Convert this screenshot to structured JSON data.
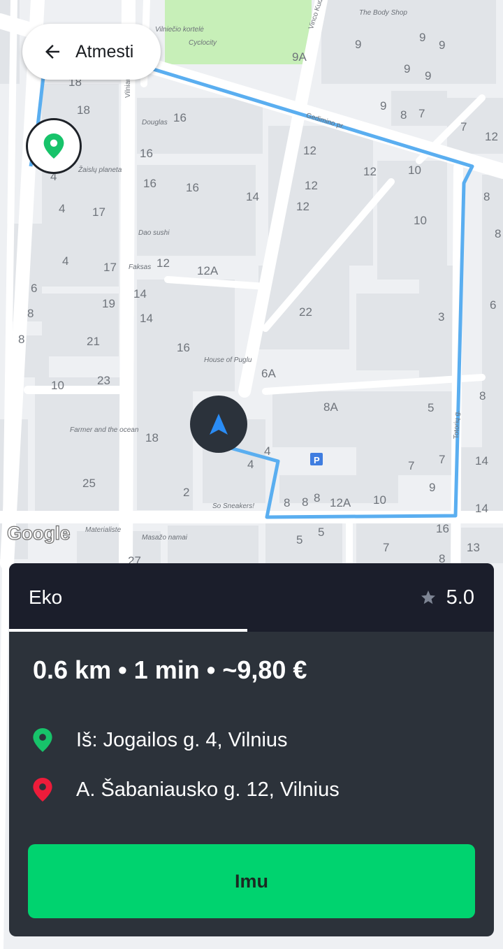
{
  "header": {
    "back_label": "Atmesti"
  },
  "map": {
    "building_numbers": [
      "18",
      "18",
      "16",
      "16",
      "16",
      "16",
      "14",
      "17",
      "4",
      "4",
      "17",
      "12",
      "12A",
      "4",
      "6",
      "19",
      "14",
      "8",
      "14",
      "21",
      "8",
      "16",
      "10",
      "23",
      "6A",
      "18",
      "8A",
      "25",
      "2",
      "4",
      "4",
      "12",
      "12",
      "12",
      "9A",
      "10",
      "12",
      "10",
      "14",
      "8",
      "8",
      "3",
      "6",
      "5",
      "7",
      "8",
      "10",
      "7",
      "9",
      "7",
      "5",
      "5",
      "9",
      "9",
      "9",
      "9",
      "9",
      "9",
      "8",
      "7",
      "7",
      "12",
      "14",
      "11",
      "16",
      "13",
      "8",
      "8",
      "8",
      "8",
      "12A",
      "22",
      "27"
    ],
    "pois": [
      "Vilniečio kortelė",
      "Cyclocity",
      "The Body Shop",
      "Douglas",
      "Žaislų planeta",
      "Dao sushi",
      "Faksas",
      "House of Puglu",
      "Farmer and the ocean",
      "So Sneakers!",
      "Materialiste",
      "Masažo namai"
    ],
    "streets": [
      "Vinco Kudirkos a.",
      "Gedimino pr.",
      "Vilniaus g.",
      "Totorių g."
    ],
    "attribution": "Google"
  },
  "ride": {
    "category": "Eko",
    "rating": "5.0",
    "summary": "0.6 km • 1 min • ~9,80 €",
    "from": "Iš: Jogailos g. 4, Vilnius",
    "to": "A. Šabaniausko g. 12, Vilnius",
    "accept_label": "Imu"
  },
  "colors": {
    "accent": "#00d36f",
    "route": "#5aaef0",
    "sheet": "#2c323a",
    "sheet_header": "#1b1e2b",
    "pickup_pin": "#17c36a",
    "dropoff_pin": "#ee1c3a"
  }
}
